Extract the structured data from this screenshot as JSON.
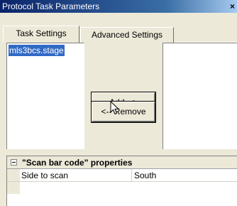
{
  "window": {
    "title": "Protocol Task Parameters",
    "close_glyph": "×"
  },
  "tabs": [
    {
      "label": "Task Settings",
      "selected": true
    },
    {
      "label": "Advanced Settings",
      "selected": false
    }
  ],
  "available_list": {
    "items": [
      {
        "label": "mls3bcs.stage",
        "selected": true
      }
    ]
  },
  "selected_list": {
    "items": []
  },
  "buttons": {
    "add_label": "Add -->",
    "remove_label": "<-- Remove"
  },
  "property_grid": {
    "category": "\"Scan bar code\" properties",
    "collapse_icon": "minus-box-icon",
    "rows": [
      {
        "name": "Side to scan",
        "value": "South"
      }
    ]
  },
  "colors": {
    "selection": "#316ac5",
    "title_bar": "#0a246a",
    "face": "#ece9d8"
  }
}
